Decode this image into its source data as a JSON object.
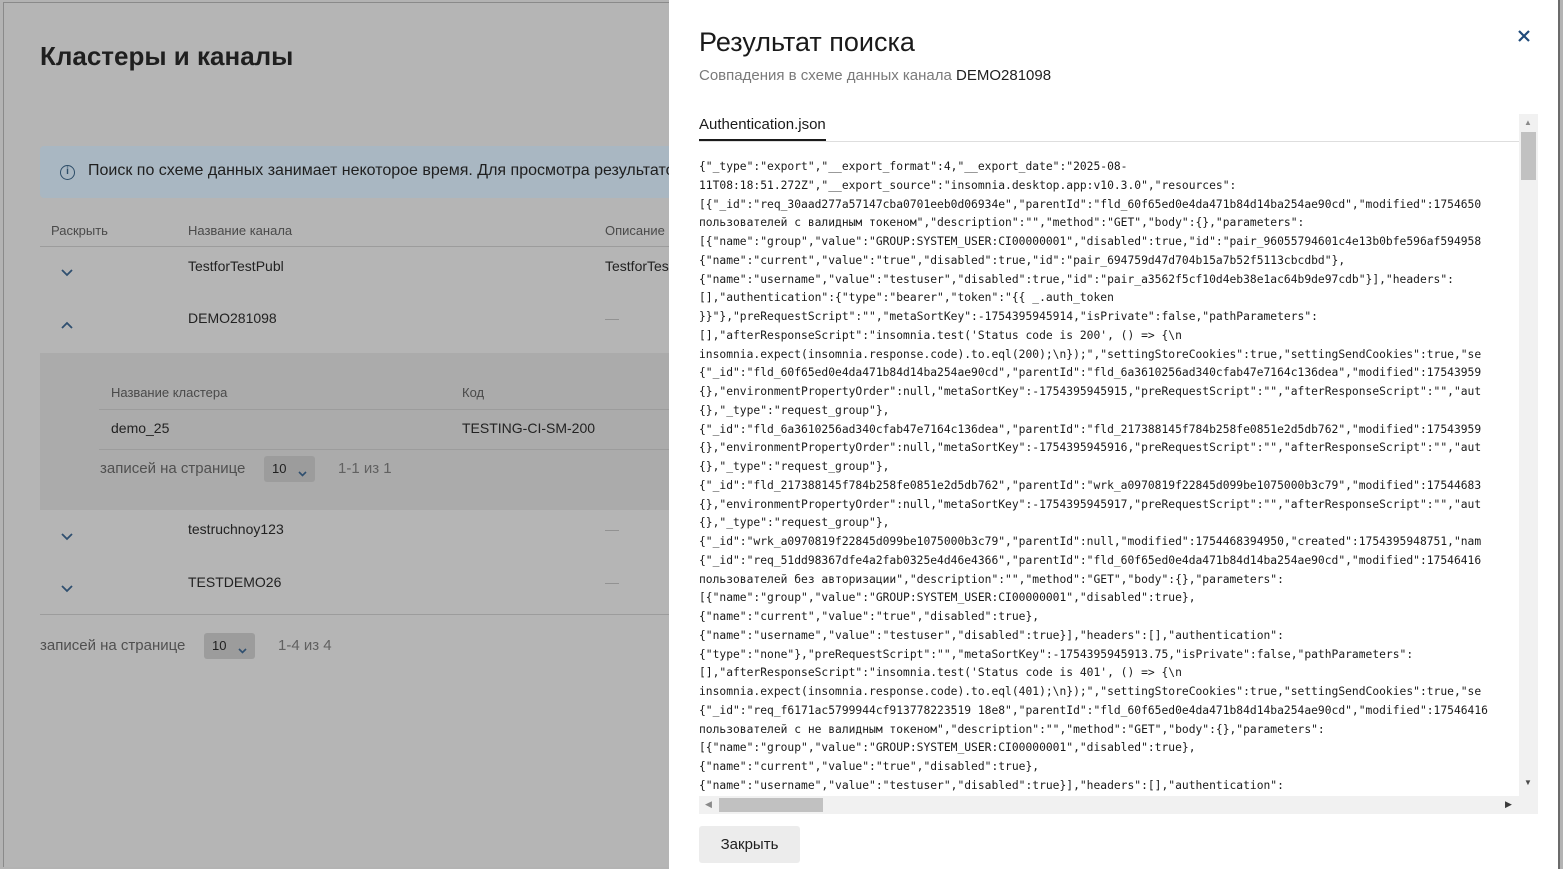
{
  "background": {
    "title": "Кластеры и каналы",
    "info_text": "Поиск по схеме данных занимает некоторое время. Для просмотра результатов",
    "table": {
      "headers": [
        "Раскрыть",
        "Название канала",
        "Описание"
      ],
      "rows": [
        {
          "name": "TestforTestPubl",
          "description": "TestforTes"
        },
        {
          "name": "DEMO281098",
          "description": "—"
        },
        {
          "name": "testruchnoy123",
          "description": "—"
        },
        {
          "name": "TESTDEMO26",
          "description": "—"
        }
      ]
    },
    "nested": {
      "headers": [
        "Название кластера",
        "Код"
      ],
      "row": {
        "cluster": "demo_25",
        "code": "TESTING-CI-SM-200"
      },
      "pager_label": "записей на странице",
      "pager_value": "10",
      "pager_count": "1-1 из 1"
    },
    "pager": {
      "label": "записей на странице",
      "value": "10",
      "count": "1-4 из 4"
    }
  },
  "drawer": {
    "title": "Результат поиска",
    "subtitle_prefix": "Совпадения в схеме данных канала",
    "channel": "DEMO281098",
    "tab": "Authentication.json",
    "close_button": "Закрыть",
    "close_icon": "close-icon",
    "code_lines": [
      "{\"_type\":\"export\",\"__export_format\":4,\"__export_date\":\"2025-08-",
      "11T08:18:51.272Z\",\"__export_source\":\"insomnia.desktop.app:v10.3.0\",\"resources\":",
      "[{\"_id\":\"req_30aad277a57147cba0701eeb0d06934e\",\"parentId\":\"fld_60f65ed0e4da471b84d14ba254ae90cd\",\"modified\":1754650",
      "пользователей с валидным токеном\",\"description\":\"\",\"method\":\"GET\",\"body\":{},\"parameters\":",
      "[{\"name\":\"group\",\"value\":\"GROUP:SYSTEM_USER:CI00000001\",\"disabled\":true,\"id\":\"pair_96055794601c4e13b0bfe596af594958",
      "{\"name\":\"current\",\"value\":\"true\",\"disabled\":true,\"id\":\"pair_694759d47d704b15a7b52f5113cbcdbd\"},",
      "{\"name\":\"username\",\"value\":\"testuser\",\"disabled\":true,\"id\":\"pair_a3562f5cf10d4eb38e1ac64b9de97cdb\"}],\"headers\":",
      "[],\"authentication\":{\"type\":\"bearer\",\"token\":\"{{ _.auth_token",
      "}}\"},\"preRequestScript\":\"\",\"metaSortKey\":-1754395945914,\"isPrivate\":false,\"pathParameters\":",
      "[],\"afterResponseScript\":\"insomnia.test('Status code is 200', () => {\\n",
      "insomnia.expect(insomnia.response.code).to.eql(200);\\n});\",\"settingStoreCookies\":true,\"settingSendCookies\":true,\"se",
      "{\"_id\":\"fld_60f65ed0e4da471b84d14ba254ae90cd\",\"parentId\":\"fld_6a3610256ad340cfab47e7164c136dea\",\"modified\":17543959",
      "{},\"environmentPropertyOrder\":null,\"metaSortKey\":-1754395945915,\"preRequestScript\":\"\",\"afterResponseScript\":\"\",\"aut",
      "{},\"_type\":\"request_group\"},",
      "{\"_id\":\"fld_6a3610256ad340cfab47e7164c136dea\",\"parentId\":\"fld_217388145f784b258fe0851e2d5db762\",\"modified\":17543959",
      "{},\"environmentPropertyOrder\":null,\"metaSortKey\":-1754395945916,\"preRequestScript\":\"\",\"afterResponseScript\":\"\",\"aut",
      "{},\"_type\":\"request_group\"},",
      "{\"_id\":\"fld_217388145f784b258fe0851e2d5db762\",\"parentId\":\"wrk_a0970819f22845d099be1075000b3c79\",\"modified\":17544683",
      "{},\"environmentPropertyOrder\":null,\"metaSortKey\":-1754395945917,\"preRequestScript\":\"\",\"afterResponseScript\":\"\",\"aut",
      "{},\"_type\":\"request_group\"},",
      "{\"_id\":\"wrk_a0970819f22845d099be1075000b3c79\",\"parentId\":null,\"modified\":1754468394950,\"created\":1754395948751,\"nam",
      "{\"_id\":\"req_51dd98367dfe4a2fab0325e4d46e4366\",\"parentId\":\"fld_60f65ed0e4da471b84d14ba254ae90cd\",\"modified\":17546416",
      "пользователей без авторизации\",\"description\":\"\",\"method\":\"GET\",\"body\":{},\"parameters\":",
      "[{\"name\":\"group\",\"value\":\"GROUP:SYSTEM_USER:CI00000001\",\"disabled\":true},",
      "{\"name\":\"current\",\"value\":\"true\",\"disabled\":true},",
      "{\"name\":\"username\",\"value\":\"testuser\",\"disabled\":true}],\"headers\":[],\"authentication\":",
      "{\"type\":\"none\"},\"preRequestScript\":\"\",\"metaSortKey\":-1754395945913.75,\"isPrivate\":false,\"pathParameters\":",
      "[],\"afterResponseScript\":\"insomnia.test('Status code is 401', () => {\\n",
      "insomnia.expect(insomnia.response.code).to.eql(401);\\n});\",\"settingStoreCookies\":true,\"settingSendCookies\":true,\"se",
      "{\"_id\":\"req_f6171ac5799944cf913778223519 18e8\",\"parentId\":\"fld_60f65ed0e4da471b84d14ba254ae90cd\",\"modified\":17546416",
      "пользователей с не валидным токеном\",\"description\":\"\",\"method\":\"GET\",\"body\":{},\"parameters\":",
      "[{\"name\":\"group\",\"value\":\"GROUP:SYSTEM_USER:CI00000001\",\"disabled\":true},",
      "{\"name\":\"current\",\"value\":\"true\",\"disabled\":true},",
      "{\"name\":\"username\",\"value\":\"testuser\",\"disabled\":true}],\"headers\":[],\"authentication\":"
    ]
  }
}
